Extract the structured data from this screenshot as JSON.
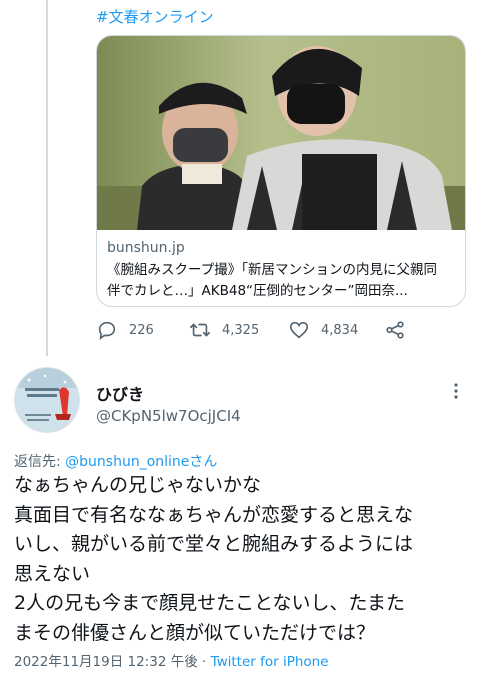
{
  "previous_tweet": {
    "hashtag": "#文春オンライン",
    "card": {
      "domain": "bunshun.jp",
      "title_line1": "《腕組みスクープ撮》「新居マンションの内見に父親同",
      "title_line2": "伴でカレと…」AKB48“圧倒的センター”岡田奈..."
    },
    "actions": {
      "reply_count": "226",
      "retweet_count": "4,325",
      "like_count": "4,834",
      "icons": [
        "reply-icon",
        "retweet-icon",
        "like-icon",
        "share-icon"
      ]
    }
  },
  "reply": {
    "user": {
      "name": "ひびき",
      "handle": "@CKpN5lw7OcjJCI4",
      "avatar_colors": {
        "bg": "#c9dde6",
        "accent": "#e0362c"
      }
    },
    "replying_to_label": "返信先: ",
    "replying_to_handle": "@bunshun_onlineさん",
    "text_lines": [
      "なぁちゃんの兄じゃないかな",
      "真面目で有名ななぁちゃんが恋愛すると思えな",
      "いし、親がいる前で堂々と腕組みするようには",
      "思えない",
      "2人の兄も今まで顔見せたことないし、たまた",
      "まその俳優さんと顔が似ていただけでは？"
    ],
    "timestamp": "2022年11月19日 12:32 午後",
    "separator": " · ",
    "source": "Twitter for iPhone"
  },
  "colors": {
    "accent": "#1d9bf0",
    "muted": "#536471",
    "border": "#cfd9de"
  }
}
